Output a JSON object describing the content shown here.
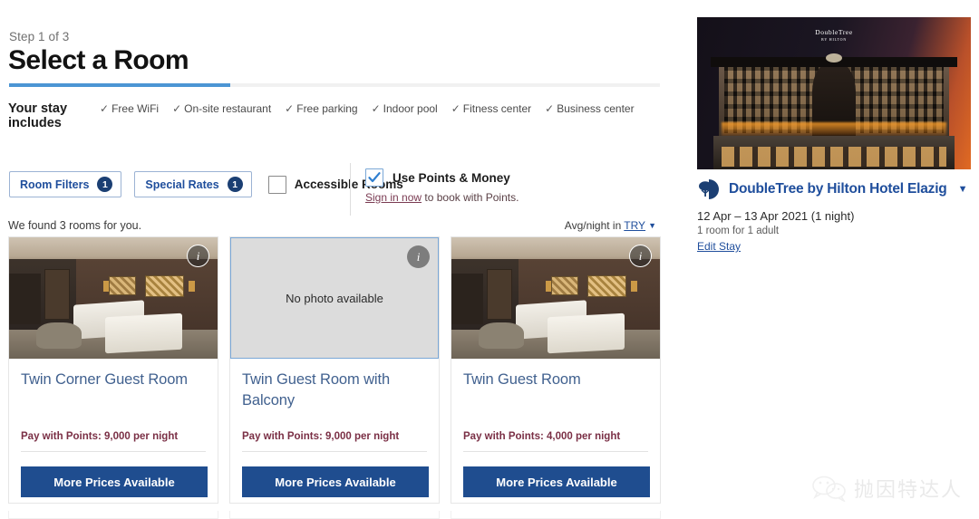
{
  "header": {
    "step_label": "Step 1 of 3",
    "title": "Select a Room",
    "progress_percent": 34
  },
  "stay_includes": {
    "label": "Your stay includes",
    "amenities": [
      "Free WiFi",
      "On-site restaurant",
      "Free parking",
      "Indoor pool",
      "Fitness center",
      "Business center"
    ],
    "tick": "✓"
  },
  "filters": {
    "room_filters_label": "Room Filters",
    "room_filters_count": "1",
    "special_rates_label": "Special Rates",
    "special_rates_count": "1",
    "accessible_rooms_label": "Accessible Rooms"
  },
  "points": {
    "checkbox_label": "Use Points & Money",
    "signin_link": "Sign in now",
    "signin_suffix": " to book with Points."
  },
  "results": {
    "found_text": "We found 3 rooms for you.",
    "avg_night_prefix": "Avg/night in",
    "currency": "TRY",
    "caret": "▼"
  },
  "rooms": [
    {
      "name": "Twin Corner Guest Room",
      "points_text": "Pay with Points: 9,000 per night",
      "cta": "More Prices Available",
      "photo": "room",
      "info_icon": "i"
    },
    {
      "name": "Twin Guest Room with Balcony",
      "points_text": "Pay with Points: 9,000 per night",
      "cta": "More Prices Available",
      "photo": "none",
      "no_photo_text": "No photo available",
      "info_icon": "i"
    },
    {
      "name": "Twin Guest Room",
      "points_text": "Pay with Points: 4,000 per night",
      "cta": "More Prices Available",
      "photo": "room",
      "info_icon": "i"
    }
  ],
  "sidebar": {
    "hotel_photo_sign": "DoubleTree",
    "hotel_photo_sign_sub": "BY HILTON",
    "hotel_name": "DoubleTree by Hilton Hotel Elazig",
    "hotel_caret": "▼",
    "stay_dates": "12 Apr – 13 Apr 2021 (1 night)",
    "stay_guests": "1 room for 1 adult",
    "edit_stay": "Edit Stay"
  },
  "watermark": {
    "text": "抛因特达人"
  },
  "colors": {
    "accent_blue": "#1f4e9c",
    "progress_blue": "#4c95d4",
    "button_blue": "#1f4d8f",
    "points_maroon": "#7a2f45",
    "badge_navy": "#1b3f73"
  }
}
